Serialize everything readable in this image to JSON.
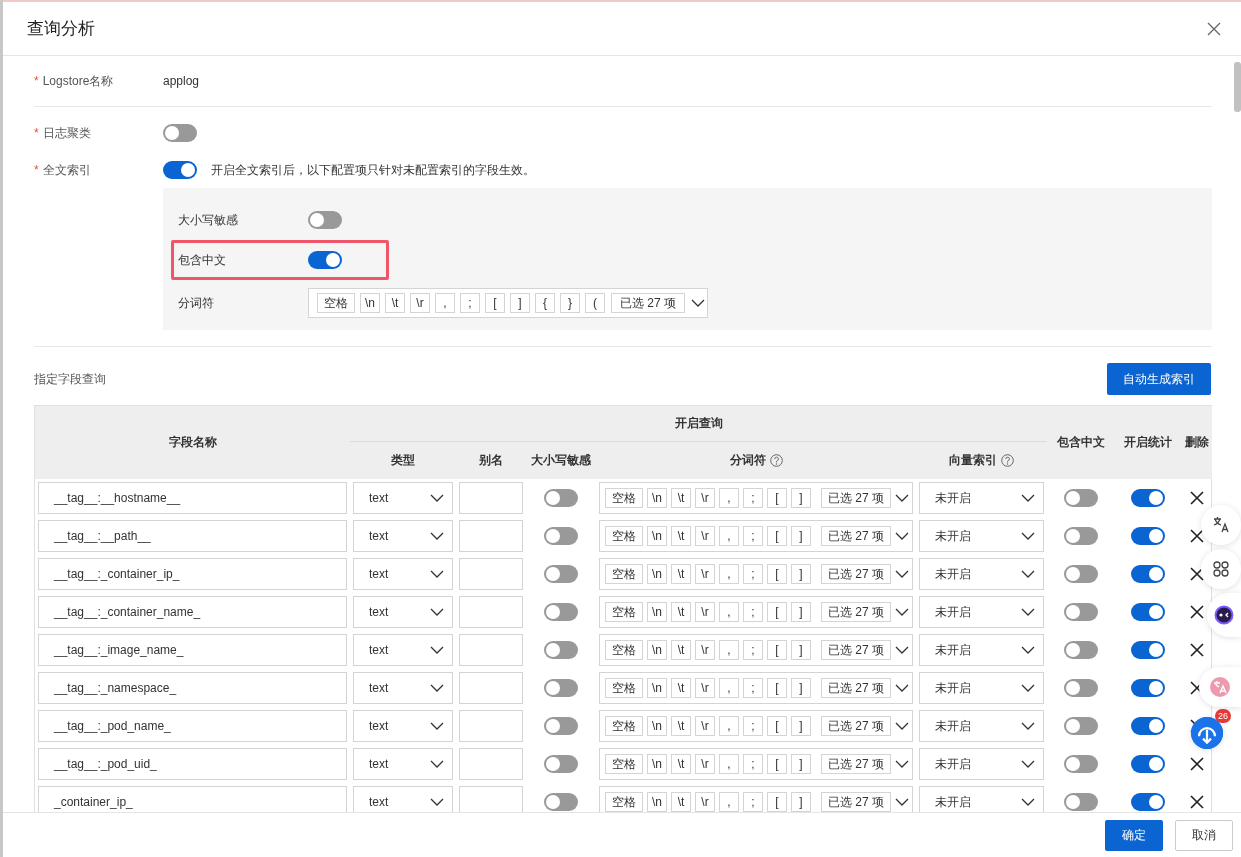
{
  "dialog": {
    "title": "查询分析"
  },
  "form": {
    "logstore": {
      "required_mark": "*",
      "label": "Logstore名称",
      "value": "applog"
    },
    "log_cluster": {
      "required_mark": "*",
      "label": "日志聚类",
      "on": false
    },
    "full_text": {
      "required_mark": "*",
      "label": "全文索引",
      "on": true,
      "hint": "开启全文索引后，以下配置项只针对未配置索引的字段生效。",
      "case_sensitive": {
        "label": "大小写敏感",
        "on": false
      },
      "include_chinese": {
        "label": "包含中文",
        "on": true,
        "highlighted": true
      },
      "delimiter": {
        "label": "分词符",
        "tokens": [
          "空格",
          "\\n",
          "\\t",
          "\\r",
          ",",
          ";",
          "[",
          "]",
          "{",
          "}",
          "("
        ],
        "summary": "已选 27 项"
      }
    }
  },
  "field_section": {
    "title": "指定字段查询",
    "auto_button": "自动生成索引"
  },
  "table": {
    "header": [
      {
        "label": "字段名称"
      },
      {
        "group": "开启查询",
        "columns": [
          {
            "label": "类型"
          },
          {
            "label": "别名"
          },
          {
            "label": "大小写敏感"
          },
          {
            "label": "分词符",
            "help": true
          },
          {
            "label": "向量索引",
            "help": true
          }
        ]
      },
      {
        "label": "包含中文"
      },
      {
        "label": "开启统计"
      },
      {
        "label": "删除"
      }
    ],
    "rows": [
      {
        "field": "__tag__:__hostname__",
        "type": "text",
        "case_sensitive": false,
        "tokens": [
          "空格",
          "\\n",
          "\\t",
          "\\r",
          ",",
          ";",
          "[",
          "]"
        ],
        "summary": "已选 27 项",
        "vector_index": "未开启",
        "include_chinese": false,
        "statistics": true
      },
      {
        "field": "__tag__:__path__",
        "type": "text",
        "case_sensitive": false,
        "tokens": [
          "空格",
          "\\n",
          "\\t",
          "\\r",
          ",",
          ";",
          "[",
          "]"
        ],
        "summary": "已选 27 项",
        "vector_index": "未开启",
        "include_chinese": false,
        "statistics": true
      },
      {
        "field": "__tag__:_container_ip_",
        "type": "text",
        "case_sensitive": false,
        "tokens": [
          "空格",
          "\\n",
          "\\t",
          "\\r",
          ",",
          ";",
          "[",
          "]"
        ],
        "summary": "已选 27 项",
        "vector_index": "未开启",
        "include_chinese": false,
        "statistics": true
      },
      {
        "field": "__tag__:_container_name_",
        "type": "text",
        "case_sensitive": false,
        "tokens": [
          "空格",
          "\\n",
          "\\t",
          "\\r",
          ",",
          ";",
          "[",
          "]"
        ],
        "summary": "已选 27 项",
        "vector_index": "未开启",
        "include_chinese": false,
        "statistics": true
      },
      {
        "field": "__tag__:_image_name_",
        "type": "text",
        "case_sensitive": false,
        "tokens": [
          "空格",
          "\\n",
          "\\t",
          "\\r",
          ",",
          ";",
          "[",
          "]"
        ],
        "summary": "已选 27 项",
        "vector_index": "未开启",
        "include_chinese": false,
        "statistics": true
      },
      {
        "field": "__tag__:_namespace_",
        "type": "text",
        "case_sensitive": false,
        "tokens": [
          "空格",
          "\\n",
          "\\t",
          "\\r",
          ",",
          ";",
          "[",
          "]"
        ],
        "summary": "已选 27 项",
        "vector_index": "未开启",
        "include_chinese": false,
        "statistics": true
      },
      {
        "field": "__tag__:_pod_name_",
        "type": "text",
        "case_sensitive": false,
        "tokens": [
          "空格",
          "\\n",
          "\\t",
          "\\r",
          ",",
          ";",
          "[",
          "]"
        ],
        "summary": "已选 27 项",
        "vector_index": "未开启",
        "include_chinese": false,
        "statistics": true
      },
      {
        "field": "__tag__:_pod_uid_",
        "type": "text",
        "case_sensitive": false,
        "tokens": [
          "空格",
          "\\n",
          "\\t",
          "\\r",
          ",",
          ";",
          "[",
          "]"
        ],
        "summary": "已选 27 项",
        "vector_index": "未开启",
        "include_chinese": false,
        "statistics": true
      },
      {
        "field": "_container_ip_",
        "type": "text",
        "case_sensitive": false,
        "tokens": [
          "空格",
          "\\n",
          "\\t",
          "\\r",
          ",",
          ";",
          "[",
          "]"
        ],
        "summary": "已选 27 项",
        "vector_index": "未开启",
        "include_chinese": false,
        "statistics": true
      }
    ]
  },
  "footer": {
    "buttons": [
      {
        "label": "确定",
        "kind": "primary"
      },
      {
        "label": "取消",
        "kind": "default"
      }
    ]
  },
  "floating_tools": [
    {
      "kind": "translate"
    },
    {
      "kind": "apps"
    },
    {
      "kind": "assistant"
    },
    {
      "kind": "translate_pink"
    },
    {
      "kind": "download",
      "badge": "26"
    }
  ]
}
